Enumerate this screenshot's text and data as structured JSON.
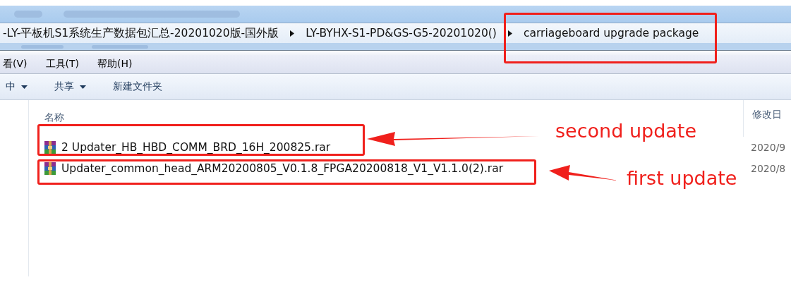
{
  "breadcrumb": {
    "items": [
      {
        "label": "-LY-平板机S1系统生产数据包汇总-20201020版-国外版",
        "highlighted": false
      },
      {
        "label": "LY-BYHX-S1-PD&GS-G5-20201020()",
        "highlighted": false
      },
      {
        "label": "carriageboard upgrade package",
        "highlighted": true
      }
    ]
  },
  "menu": [
    "看(V)",
    "工具(T)",
    "帮助(H)"
  ],
  "toolbar": [
    {
      "label": "中",
      "dropdown": true
    },
    {
      "label": "共享",
      "dropdown": true
    },
    {
      "label": "新建文件夹",
      "dropdown": false
    }
  ],
  "table": {
    "columns": [
      "名称",
      "修改日"
    ],
    "rows": [
      {
        "name": "2 Updater_HB_HBD_COMM_BRD_16H_200825.rar",
        "date": "2020/9",
        "highlighted": true
      },
      {
        "name": "Updater_common_head_ARM20200805_V0.1.8_FPGA20200818_V1_V1.1.0(2).rar",
        "date": "2020/8",
        "highlighted": true
      }
    ]
  },
  "annotations": [
    {
      "label": "second update"
    },
    {
      "label": "first update"
    }
  ]
}
